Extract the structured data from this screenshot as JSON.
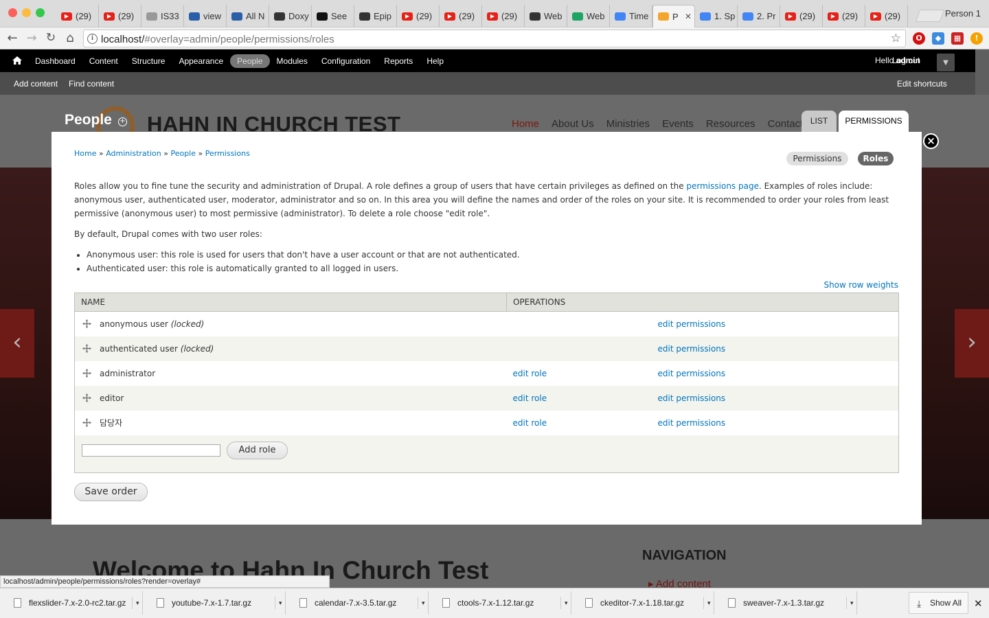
{
  "browser": {
    "tabs": [
      {
        "title": "(29)",
        "favicon": "youtube-icon",
        "color": "#e62117"
      },
      {
        "title": "(29)",
        "favicon": "youtube-icon",
        "color": "#e62117"
      },
      {
        "title": "IS33",
        "favicon": "document-icon",
        "color": "#999999"
      },
      {
        "title": "view",
        "favicon": "drupal-icon",
        "color": "#2b5ea8"
      },
      {
        "title": "All N",
        "favicon": "drupal-icon",
        "color": "#2b5ea8"
      },
      {
        "title": "Doxy",
        "favicon": "doxy-icon",
        "color": "#333333"
      },
      {
        "title": "See",
        "favicon": "see-icon",
        "color": "#111111"
      },
      {
        "title": "Epip",
        "favicon": "edge-icon",
        "color": "#333333"
      },
      {
        "title": "(29)",
        "favicon": "youtube-icon",
        "color": "#e62117"
      },
      {
        "title": "(29)",
        "favicon": "youtube-icon",
        "color": "#e62117"
      },
      {
        "title": "(29)",
        "favicon": "youtube-icon",
        "color": "#e62117"
      },
      {
        "title": "Web",
        "favicon": "trello-icon",
        "color": "#333333"
      },
      {
        "title": "Web",
        "favicon": "drive-icon",
        "color": "#1da462"
      },
      {
        "title": "Time",
        "favicon": "docs-icon",
        "color": "#4285f4"
      },
      {
        "title": "P",
        "favicon": "loading-icon",
        "color": "#f4a52c",
        "active": true
      },
      {
        "title": "1. Sp",
        "favicon": "docs-icon",
        "color": "#4285f4"
      },
      {
        "title": "2. Pr",
        "favicon": "docs-icon",
        "color": "#4285f4"
      },
      {
        "title": "(29)",
        "favicon": "youtube-icon",
        "color": "#e62117"
      },
      {
        "title": "(29)",
        "favicon": "youtube-icon",
        "color": "#e62117"
      },
      {
        "title": "(29)",
        "favicon": "youtube-icon",
        "color": "#e62117"
      }
    ],
    "profile": "Person 1",
    "url_host": "localhost/",
    "url_path": "#overlay=admin/people/permissions/roles",
    "status_url": "localhost/admin/people/permissions/roles?render=overlay#"
  },
  "admin_toolbar": {
    "items": [
      "Dashboard",
      "Content",
      "Structure",
      "Appearance",
      "People",
      "Modules",
      "Configuration",
      "Reports",
      "Help"
    ],
    "active": "People",
    "hello_prefix": "Hello",
    "user": "admin",
    "logout": "Log out",
    "shortcuts": {
      "add": "Add content",
      "find": "Find content",
      "edit": "Edit shortcuts"
    }
  },
  "site": {
    "title": "HAHN IN CHURCH TEST",
    "menu": [
      "Home",
      "About Us",
      "Ministries",
      "Events",
      "Resources",
      "Contact U"
    ],
    "welcome": "Welcome to Hahn In Church Test",
    "navigation_heading": "NAVIGATION",
    "navigation_item": "Add content",
    "accent": "#6e1a17"
  },
  "overlay": {
    "title": "People",
    "tabs": {
      "list": "LIST",
      "permissions": "PERMISSIONS"
    },
    "breadcrumb": [
      "Home",
      "Administration",
      "People",
      "Permissions"
    ],
    "breadcrumb_sep": "»",
    "secondary": {
      "permissions": "Permissions",
      "roles": "Roles"
    },
    "help": {
      "p1_before": "Roles allow you to fine tune the security and administration of Drupal. A role defines a group of users that have certain privileges as defined on the ",
      "p1_link": "permissions page",
      "p1_after": ". Examples of roles include: anonymous user, authenticated user, moderator, administrator and so on. In this area you will define the names and order of the roles on your site. It is recommended to order your roles from least permissive (anonymous user) to most permissive (administrator). To delete a role choose \"edit role\".",
      "p2": "By default, Drupal comes with two user roles:",
      "li1": "Anonymous user: this role is used for users that don't have a user account or that are not authenticated.",
      "li2": "Authenticated user: this role is automatically granted to all logged in users."
    },
    "show_row_weights": "Show row weights",
    "table": {
      "headers": {
        "name": "NAME",
        "operations": "OPERATIONS"
      },
      "rows": [
        {
          "name": "anonymous user",
          "locked": "(locked)",
          "edit_role": "",
          "edit_permissions": "edit permissions"
        },
        {
          "name": "authenticated user",
          "locked": "(locked)",
          "edit_role": "",
          "edit_permissions": "edit permissions"
        },
        {
          "name": "administrator",
          "locked": "",
          "edit_role": "edit role",
          "edit_permissions": "edit permissions"
        },
        {
          "name": "editor",
          "locked": "",
          "edit_role": "edit role",
          "edit_permissions": "edit permissions"
        },
        {
          "name": "담당자",
          "locked": "",
          "edit_role": "edit role",
          "edit_permissions": "edit permissions"
        }
      ]
    },
    "new_role_value": "",
    "add_role": "Add role",
    "save_order": "Save order",
    "link_color": "#0074bd"
  },
  "downloads": {
    "files": [
      "flexslider-7.x-2.0-rc2.tar.gz",
      "youtube-7.x-1.7.tar.gz",
      "calendar-7.x-3.5.tar.gz",
      "ctools-7.x-1.12.tar.gz",
      "ckeditor-7.x-1.18.tar.gz",
      "sweaver-7.x-1.3.tar.gz"
    ],
    "show_all": "Show All"
  }
}
